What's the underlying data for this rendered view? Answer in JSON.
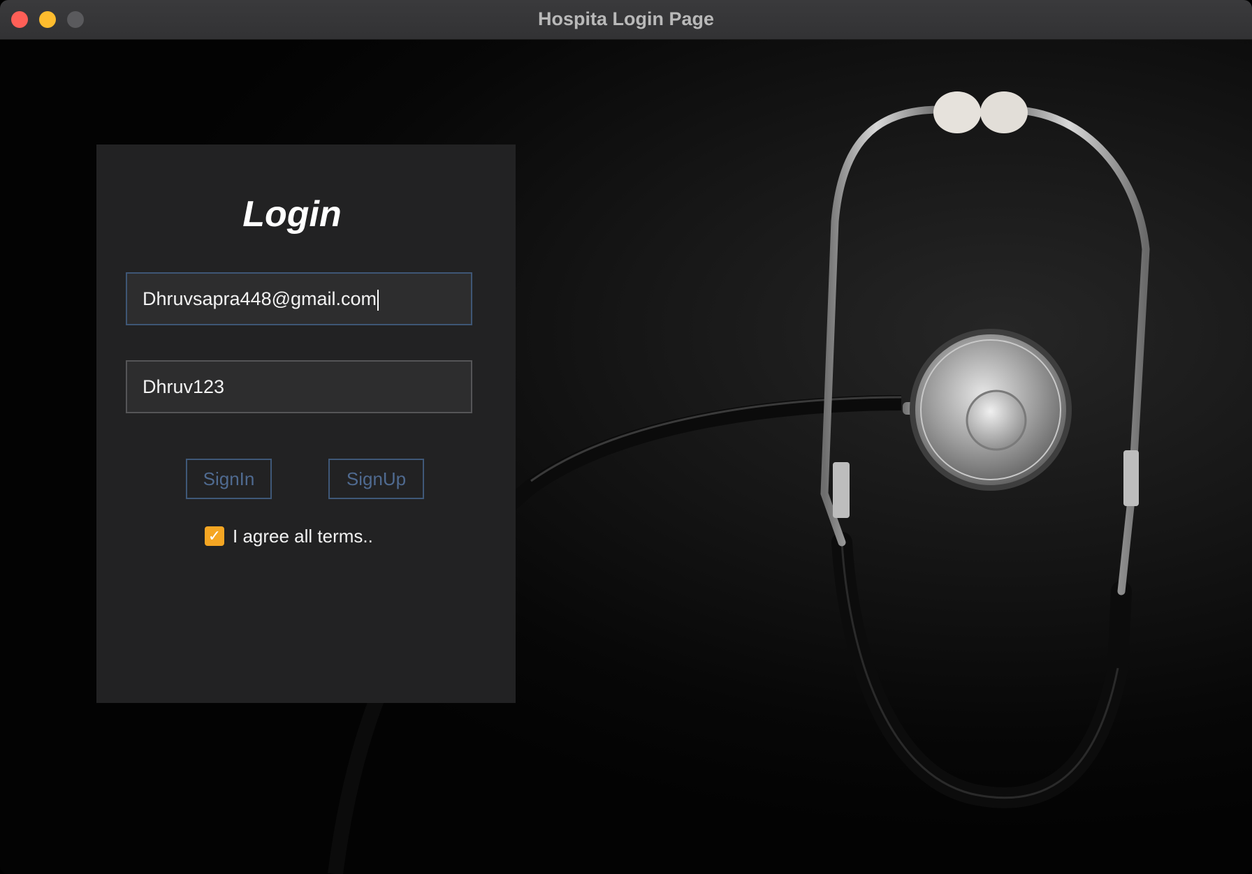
{
  "window": {
    "title": "Hospita Login Page"
  },
  "login": {
    "heading": "Login",
    "email_value": "Dhruvsapra448@gmail.com",
    "password_value": "Dhruv123",
    "signin_label": "SignIn",
    "signup_label": "SignUp",
    "agree_label": "I agree all terms..",
    "agree_checked": true
  },
  "colors": {
    "checkbox": "#f5a623",
    "button_border": "#3f5878",
    "panel": "#222223"
  },
  "icons": {
    "close": "close-icon",
    "minimize": "minimize-icon",
    "maximize": "maximize-icon",
    "checkmark": "checkmark-icon"
  }
}
